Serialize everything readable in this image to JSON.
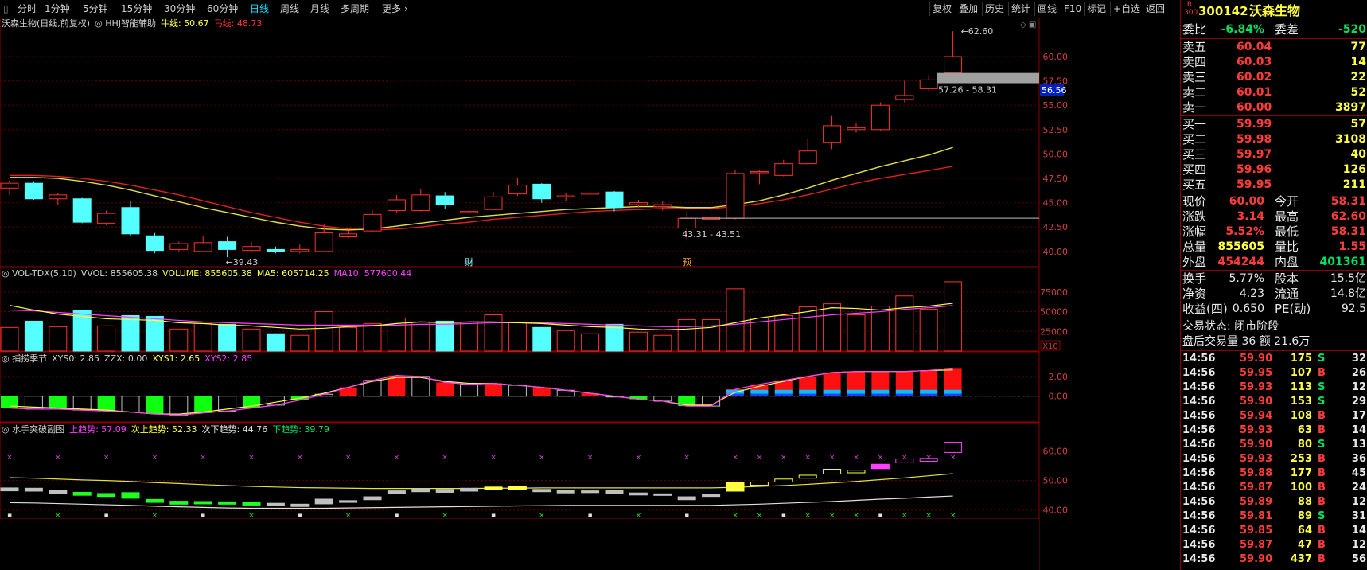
{
  "toolbar": {
    "periods": [
      "分时",
      "1分钟",
      "5分钟",
      "15分钟",
      "30分钟",
      "60分钟",
      "日线",
      "周线",
      "月线",
      "多周期",
      "更多"
    ],
    "active_period": "日线",
    "buttons": [
      "复权",
      "叠加",
      "历史",
      "统计",
      "画线",
      "F10",
      "标记",
      "+自选",
      "返回"
    ]
  },
  "main_panel": {
    "title": "沃森生物(日线,前复权)",
    "indicator": "HHJ智能辅助",
    "label_niu": "牛线:",
    "niu_value": "50.67",
    "label_ma": "马线:",
    "ma_value": "48.73",
    "annotation_high": "62.60",
    "annotation_low": "39.43",
    "range1": "57.26 - 58.31",
    "range2": "43.31 - 43.51",
    "price_tag": "56.56",
    "marker_cai": "财",
    "marker_yu": "预",
    "y_ticks": [
      "60.00",
      "57.50",
      "55.00",
      "52.50",
      "50.00",
      "47.50",
      "45.00",
      "42.50",
      "40.00"
    ]
  },
  "vol_panel": {
    "name": "VOL-TDX(5,10)",
    "vvol": "VVOL: 855605.38",
    "volume": "VOLUME: 855605.38",
    "ma5": "MA5: 605714.25",
    "ma10": "MA10: 577600.44",
    "y_ticks": [
      "75000",
      "50000",
      "25000"
    ],
    "unit": "X10"
  },
  "season_panel": {
    "name": "捕捞季节",
    "xys0": "XYS0: 2.85",
    "zzx": "ZZX: 0.00",
    "xys1": "XYS1: 2.65",
    "xys2": "XYS2: 2.85",
    "y_ticks": [
      "2.00",
      "0.00"
    ]
  },
  "sailor_panel": {
    "name": "水手突破副图",
    "up": "上趋势: 57.09",
    "up2": "次上趋势: 52.33",
    "down2": "次下趋势: 44.76",
    "down": "下趋势: 39.79",
    "y_ticks": [
      "60.00",
      "50.00",
      "40.00"
    ]
  },
  "chart_data": {
    "type": "candlestick",
    "candles": [
      [
        46.5,
        47.0,
        47.3,
        45.8
      ],
      [
        47.0,
        45.4,
        47.2,
        45.3
      ],
      [
        45.4,
        45.8,
        46.0,
        44.8
      ],
      [
        45.4,
        43.0,
        45.5,
        42.9
      ],
      [
        42.9,
        43.9,
        44.2,
        42.7
      ],
      [
        44.5,
        41.8,
        45.2,
        41.6
      ],
      [
        41.6,
        40.1,
        41.9,
        39.8
      ],
      [
        40.2,
        40.8,
        41.0,
        40.0
      ],
      [
        40.0,
        40.9,
        41.6,
        39.9
      ],
      [
        41.0,
        40.2,
        41.5,
        39.4
      ],
      [
        40.1,
        40.5,
        41.0,
        39.9
      ],
      [
        40.2,
        40.0,
        40.5,
        39.8
      ],
      [
        40.0,
        40.2,
        40.7,
        39.8
      ],
      [
        40.0,
        41.9,
        42.8,
        39.9
      ],
      [
        41.5,
        41.8,
        42.2,
        41.4
      ],
      [
        42.1,
        43.8,
        44.2,
        42.0
      ],
      [
        44.2,
        45.3,
        45.8,
        44.0
      ],
      [
        44.2,
        45.8,
        46.4,
        44.1
      ],
      [
        45.7,
        44.8,
        46.1,
        44.4
      ],
      [
        44.0,
        44.1,
        44.7,
        43.2
      ],
      [
        44.3,
        45.6,
        46.1,
        44.2
      ],
      [
        45.9,
        46.8,
        47.5,
        45.7
      ],
      [
        46.9,
        45.4,
        47.0,
        45.0
      ],
      [
        45.6,
        45.7,
        46.0,
        45.2
      ],
      [
        45.9,
        46.0,
        46.3,
        45.5
      ],
      [
        46.1,
        44.5,
        46.2,
        44.1
      ],
      [
        44.8,
        45.0,
        45.3,
        44.5
      ],
      [
        44.6,
        44.8,
        45.2,
        44.2
      ],
      [
        42.4,
        43.4,
        44.1,
        41.1
      ],
      [
        43.3,
        43.5,
        45.0,
        43.3
      ],
      [
        43.4,
        48.0,
        48.4,
        43.3
      ],
      [
        48.1,
        48.2,
        48.4,
        46.9
      ],
      [
        47.8,
        49.0,
        49.4,
        47.7
      ],
      [
        49.0,
        50.3,
        51.6,
        48.9
      ],
      [
        51.2,
        52.9,
        53.9,
        50.5
      ],
      [
        52.5,
        52.7,
        53.2,
        52.2
      ],
      [
        52.5,
        55.0,
        55.3,
        52.4
      ],
      [
        55.6,
        56.0,
        57.5,
        55.3
      ],
      [
        56.7,
        57.6,
        58.1,
        56.5
      ],
      [
        58.31,
        60.0,
        62.6,
        58.31
      ]
    ],
    "ma_yellow": [
      47.6,
      47.6,
      47.5,
      47.2,
      46.8,
      46.3,
      45.7,
      45.1,
      44.5,
      44.0,
      43.5,
      43.0,
      42.6,
      42.3,
      42.2,
      42.3,
      42.6,
      42.9,
      43.2,
      43.5,
      43.7,
      43.9,
      44.1,
      44.3,
      44.4,
      44.5,
      44.6,
      44.6,
      44.5,
      44.5,
      44.8,
      45.2,
      45.8,
      46.5,
      47.3,
      48.0,
      48.7,
      49.3,
      49.9,
      50.67
    ],
    "ma_red": [
      47.8,
      47.8,
      47.7,
      47.5,
      47.2,
      46.8,
      46.3,
      45.8,
      45.2,
      44.6,
      44.0,
      43.5,
      43.0,
      42.6,
      42.3,
      42.2,
      42.3,
      42.5,
      42.8,
      43.0,
      43.3,
      43.5,
      43.7,
      43.9,
      44.1,
      44.2,
      44.3,
      44.4,
      44.4,
      44.4,
      44.6,
      44.9,
      45.3,
      45.8,
      46.4,
      47.0,
      47.5,
      47.9,
      48.3,
      48.73
    ],
    "volume": [
      30000,
      38000,
      31000,
      52000,
      32000,
      45000,
      44000,
      28000,
      35000,
      34000,
      28000,
      22000,
      20000,
      50000,
      30000,
      35000,
      42000,
      37000,
      38000,
      37000,
      46000,
      37000,
      30000,
      26000,
      22000,
      34000,
      24000,
      20000,
      40000,
      40000,
      79000,
      42000,
      45000,
      56000,
      60000,
      46000,
      57000,
      70000,
      53000,
      88000
    ],
    "vol_ma5": [
      58000,
      52000,
      47000,
      44000,
      41000,
      40000,
      39000,
      36000,
      35000,
      33000,
      32000,
      30000,
      28000,
      29000,
      31000,
      32000,
      35000,
      37000,
      36000,
      37000,
      37000,
      36000,
      35000,
      33000,
      31000,
      30000,
      28000,
      27000,
      28000,
      30000,
      36000,
      42000,
      46000,
      50000,
      55000,
      54000,
      52000,
      55000,
      57000,
      60571
    ],
    "vol_ma10": [
      52000,
      51000,
      49000,
      47000,
      45000,
      43000,
      41000,
      39000,
      37000,
      36000,
      35000,
      34000,
      33000,
      33000,
      33000,
      33000,
      33000,
      34000,
      34000,
      35000,
      36000,
      36000,
      36000,
      35000,
      34000,
      33000,
      32000,
      31000,
      31000,
      32000,
      34000,
      37000,
      40000,
      43000,
      46000,
      48000,
      50000,
      53000,
      55000,
      57760
    ],
    "season_bars": [
      -1.2,
      -1.3,
      -1.3,
      -1.4,
      -1.5,
      -1.6,
      -1.8,
      -1.9,
      -1.7,
      -1.5,
      -1.2,
      -0.9,
      -0.4,
      0.2,
      0.9,
      1.6,
      2.1,
      2.0,
      1.4,
      1.2,
      1.3,
      1.1,
      0.9,
      0.6,
      0.3,
      0.0,
      -0.3,
      -0.5,
      -1.0,
      -1.0,
      0.7,
      1.2,
      1.6,
      2.0,
      2.4,
      2.5,
      2.5,
      2.5,
      2.6,
      2.85
    ],
    "season_line": [
      -1.0,
      -1.1,
      -1.2,
      -1.3,
      -1.4,
      -1.6,
      -1.8,
      -1.8,
      -1.6,
      -1.3,
      -1.0,
      -0.6,
      -0.2,
      0.3,
      0.9,
      1.5,
      1.9,
      1.9,
      1.5,
      1.3,
      1.3,
      1.1,
      0.9,
      0.6,
      0.3,
      0.0,
      -0.3,
      -0.5,
      -0.9,
      -0.9,
      0.4,
      1.0,
      1.5,
      2.0,
      2.4,
      2.5,
      2.5,
      2.5,
      2.6,
      2.65
    ],
    "sailor_yellow": [
      51.0,
      50.8,
      50.5,
      50.2,
      50.0,
      49.7,
      49.3,
      49.0,
      48.6,
      48.3,
      48.0,
      47.8,
      47.6,
      47.5,
      47.4,
      47.3,
      47.3,
      47.3,
      47.3,
      47.3,
      47.4,
      47.4,
      47.5,
      47.5,
      47.5,
      47.5,
      47.5,
      47.5,
      47.5,
      47.5,
      47.7,
      48.0,
      48.3,
      48.7,
      49.2,
      49.7,
      50.3,
      50.9,
      51.6,
      52.33
    ],
    "sailor_white": [
      42.5,
      42.4,
      42.2,
      42.0,
      41.8,
      41.6,
      41.3,
      41.1,
      40.9,
      40.7,
      40.6,
      40.6,
      40.6,
      40.6,
      40.7,
      40.8,
      40.9,
      41.0,
      41.1,
      41.2,
      41.3,
      41.4,
      41.5,
      41.6,
      41.6,
      41.6,
      41.6,
      41.6,
      41.6,
      41.6,
      41.8,
      42.0,
      42.3,
      42.6,
      42.9,
      43.3,
      43.7,
      44.0,
      44.4,
      44.76
    ],
    "sailor_boxes": [
      [
        47.5,
        46.5
      ],
      [
        47.4,
        46.4
      ],
      [
        46.6,
        45.6
      ],
      [
        46.0,
        45.0
      ],
      [
        45.6,
        44.6
      ],
      [
        45.9,
        44.0
      ],
      [
        43.6,
        42.6
      ],
      [
        43.0,
        42.0
      ],
      [
        42.9,
        42.1
      ],
      [
        42.8,
        42.0
      ],
      [
        42.5,
        41.7
      ],
      [
        42.3,
        41.5
      ],
      [
        42.0,
        41.2
      ],
      [
        43.7,
        42.1
      ],
      [
        43.2,
        42.6
      ],
      [
        44.5,
        43.5
      ],
      [
        46.5,
        45.5
      ],
      [
        47.2,
        46.2
      ],
      [
        47.0,
        46.0
      ],
      [
        47.4,
        46.4
      ],
      [
        47.8,
        46.8
      ],
      [
        47.9,
        47.0
      ],
      [
        47.0,
        46.2
      ],
      [
        46.6,
        45.8
      ],
      [
        46.5,
        45.9
      ],
      [
        46.7,
        45.7
      ],
      [
        45.8,
        45.1
      ],
      [
        45.5,
        45.0
      ],
      [
        44.5,
        43.5
      ],
      [
        45.3,
        44.6
      ],
      [
        49.5,
        46.4
      ],
      [
        49.5,
        48.4
      ],
      [
        50.5,
        49.5
      ],
      [
        51.8,
        50.8
      ],
      [
        53.8,
        52.2
      ],
      [
        53.5,
        52.6
      ],
      [
        55.5,
        54.0
      ],
      [
        57.3,
        56.0
      ],
      [
        57.5,
        56.5
      ],
      [
        63.0,
        59.5
      ]
    ],
    "y_range": [
      38.6,
      64.0
    ]
  },
  "quote": {
    "code": "300142",
    "name": "沃森生物",
    "badge_top": "R",
    "badge_bottom": "300",
    "webi_label": "委比",
    "webi_value": "-6.84%",
    "wecha_label": "委差",
    "wecha_value": "-520",
    "asks": [
      {
        "label": "卖五",
        "price": "60.04",
        "vol": "77"
      },
      {
        "label": "卖四",
        "price": "60.03",
        "vol": "14"
      },
      {
        "label": "卖三",
        "price": "60.02",
        "vol": "22"
      },
      {
        "label": "卖二",
        "price": "60.01",
        "vol": "52"
      },
      {
        "label": "卖一",
        "price": "60.00",
        "vol": "3897"
      }
    ],
    "bids": [
      {
        "label": "买一",
        "price": "59.99",
        "vol": "57"
      },
      {
        "label": "买二",
        "price": "59.98",
        "vol": "3108"
      },
      {
        "label": "买三",
        "price": "59.97",
        "vol": "40"
      },
      {
        "label": "买四",
        "price": "59.96",
        "vol": "126"
      },
      {
        "label": "买五",
        "price": "59.95",
        "vol": "211"
      }
    ],
    "stats": [
      {
        "l1": "现价",
        "v1": "60.00",
        "c1": "red",
        "l2": "今开",
        "v2": "58.31",
        "c2": "red"
      },
      {
        "l1": "涨跌",
        "v1": "3.14",
        "c1": "red",
        "l2": "最高",
        "v2": "62.60",
        "c2": "red"
      },
      {
        "l1": "涨幅",
        "v1": "5.52%",
        "c1": "red",
        "l2": "最低",
        "v2": "58.31",
        "c2": "red"
      },
      {
        "l1": "总量",
        "v1": "855605",
        "c1": "yel",
        "l2": "量比",
        "v2": "1.55",
        "c2": "red"
      },
      {
        "l1": "外盘",
        "v1": "454244",
        "c1": "red",
        "l2": "内盘",
        "v2": "401361",
        "c2": "green"
      }
    ],
    "stats2": [
      {
        "l1": "换手",
        "v1": "5.77%",
        "l2": "股本",
        "v2": "15.5亿"
      },
      {
        "l1": "净资",
        "v1": "4.23",
        "l2": "流通",
        "v2": "14.8亿"
      },
      {
        "l1": "收益(四)",
        "v1": "0.650",
        "l2": "PE(动)",
        "v2": "92.5"
      }
    ],
    "status": "交易状态: 闭市阶段",
    "after_hours": "盘后交易量 36 额 21.6万",
    "ticks": [
      {
        "t": "14:56",
        "p": "59.90",
        "v": "175",
        "s": "S",
        "n": "32"
      },
      {
        "t": "14:56",
        "p": "59.95",
        "v": "107",
        "s": "B",
        "n": "26"
      },
      {
        "t": "14:56",
        "p": "59.93",
        "v": "113",
        "s": "S",
        "n": "12"
      },
      {
        "t": "14:56",
        "p": "59.90",
        "v": "153",
        "s": "S",
        "n": "29"
      },
      {
        "t": "14:56",
        "p": "59.94",
        "v": "108",
        "s": "B",
        "n": "17"
      },
      {
        "t": "14:56",
        "p": "59.93",
        "v": "63",
        "s": "B",
        "n": "14"
      },
      {
        "t": "14:56",
        "p": "59.90",
        "v": "80",
        "s": "S",
        "n": "13"
      },
      {
        "t": "14:56",
        "p": "59.93",
        "v": "253",
        "s": "B",
        "n": "36"
      },
      {
        "t": "14:56",
        "p": "59.88",
        "v": "177",
        "s": "B",
        "n": "45"
      },
      {
        "t": "14:56",
        "p": "59.87",
        "v": "100",
        "s": "B",
        "n": "24"
      },
      {
        "t": "14:56",
        "p": "59.89",
        "v": "88",
        "s": "B",
        "n": "12"
      },
      {
        "t": "14:56",
        "p": "59.81",
        "v": "89",
        "s": "S",
        "n": "31"
      },
      {
        "t": "14:56",
        "p": "59.85",
        "v": "64",
        "s": "B",
        "n": "14"
      },
      {
        "t": "14:56",
        "p": "59.87",
        "v": "47",
        "s": "B",
        "n": "12"
      },
      {
        "t": "14:56",
        "p": "59.90",
        "v": "437",
        "s": "B",
        "n": "56"
      }
    ]
  }
}
